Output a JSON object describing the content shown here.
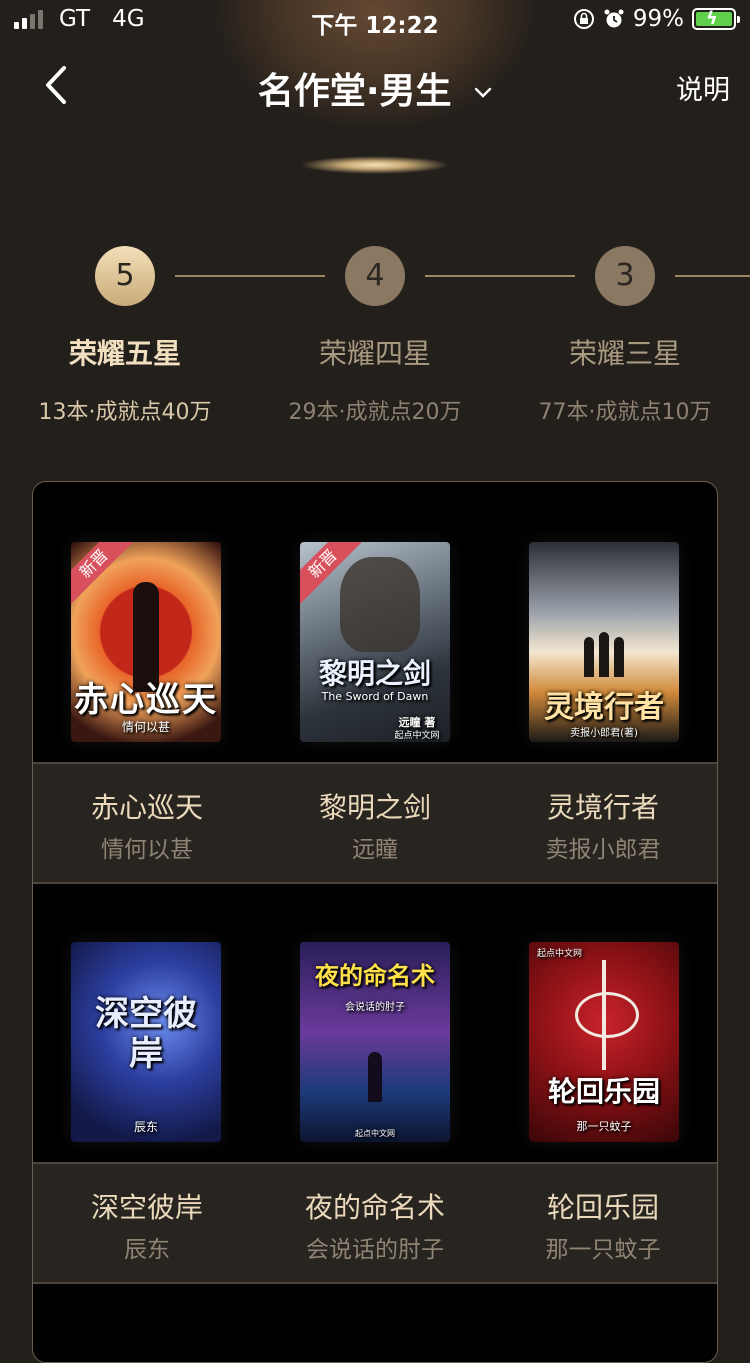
{
  "status_bar": {
    "carrier": "GT",
    "network": "4G",
    "time": "下午 12:22",
    "battery": "99%"
  },
  "nav": {
    "title": "名作堂·男生",
    "help": "说明"
  },
  "tiers": [
    {
      "number": "5",
      "name": "荣耀五星",
      "meta": "13本·成就点40万"
    },
    {
      "number": "4",
      "name": "荣耀四星",
      "meta": "29本·成就点20万"
    },
    {
      "number": "3",
      "name": "荣耀三星",
      "meta": "77本·成就点10万"
    }
  ],
  "books": [
    {
      "title": "赤心巡天",
      "author": "情何以甚",
      "badge": "新晋",
      "cover_title": "赤心巡天",
      "cover_sub": "情何以甚"
    },
    {
      "title": "黎明之剑",
      "author": "远瞳",
      "badge": "新晋",
      "cover_title": "黎明之剑",
      "cover_sub": "The Sword of Dawn",
      "cover_sign": "远瞳 著",
      "cover_publisher": "起点中文网"
    },
    {
      "title": "灵境行者",
      "author": "卖报小郎君",
      "cover_title": "灵境行者",
      "cover_sub": "卖报小郎君(著)"
    },
    {
      "title": "深空彼岸",
      "author": "辰东",
      "cover_title": "深空彼岸",
      "cover_sub": "辰东"
    },
    {
      "title": "夜的命名术",
      "author": "会说话的肘子",
      "cover_title": "夜的命名术",
      "cover_sub": "会说话的肘子",
      "cover_publisher": "起点中文网"
    },
    {
      "title": "轮回乐园",
      "author": "那一只蚊子",
      "cover_title": "轮回乐园",
      "cover_sub": "那一只蚊子",
      "cover_publisher": "起点中文网"
    }
  ],
  "colors": {
    "background": "#231f1b",
    "gold": "#c9ab79",
    "badge": "#d7505b"
  },
  "icons": [
    "back-arrow-icon",
    "chevron-down-icon",
    "orientation-lock-icon",
    "alarm-icon",
    "battery-icon",
    "signal-icon"
  ]
}
